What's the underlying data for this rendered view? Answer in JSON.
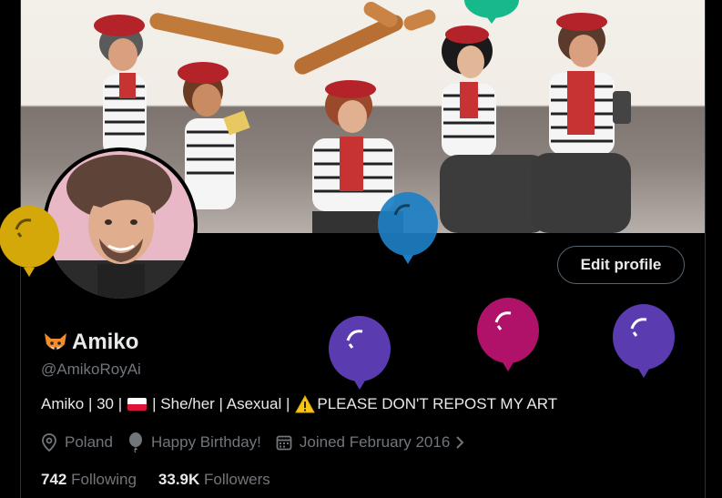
{
  "profile": {
    "display_name": "Amiko",
    "handle": "@AmikoRoyAi",
    "edit_button_label": "Edit profile",
    "name_emoji": "fox-face-icon"
  },
  "bio": {
    "part1": "Amiko | 30 |",
    "flag": "poland-flag-icon",
    "part2": "| She/her | Asexual |",
    "warning_icon": "warning-icon",
    "part3": "PLEASE DON'T REPOST MY ART"
  },
  "meta": {
    "location": "Poland",
    "birthday": "Happy Birthday!",
    "joined": "Joined February 2016"
  },
  "stats": {
    "following_count": "742",
    "following_label": "Following",
    "followers_count": "33.9K",
    "followers_label": "Followers"
  },
  "balloons": [
    {
      "name": "yellow-balloon",
      "color": "#d4a808"
    },
    {
      "name": "green-balloon",
      "color": "#17b889"
    },
    {
      "name": "blue-balloon",
      "color": "#1d7fc4"
    },
    {
      "name": "purple-balloon",
      "color": "#5b3bb0"
    },
    {
      "name": "magenta-balloon",
      "color": "#b0126a"
    },
    {
      "name": "purple-balloon-right",
      "color": "#5b3bb0"
    }
  ],
  "colors": {
    "background": "#000000",
    "text_primary": "#e7e9ea",
    "text_secondary": "#71767b",
    "border": "#2f3336"
  }
}
